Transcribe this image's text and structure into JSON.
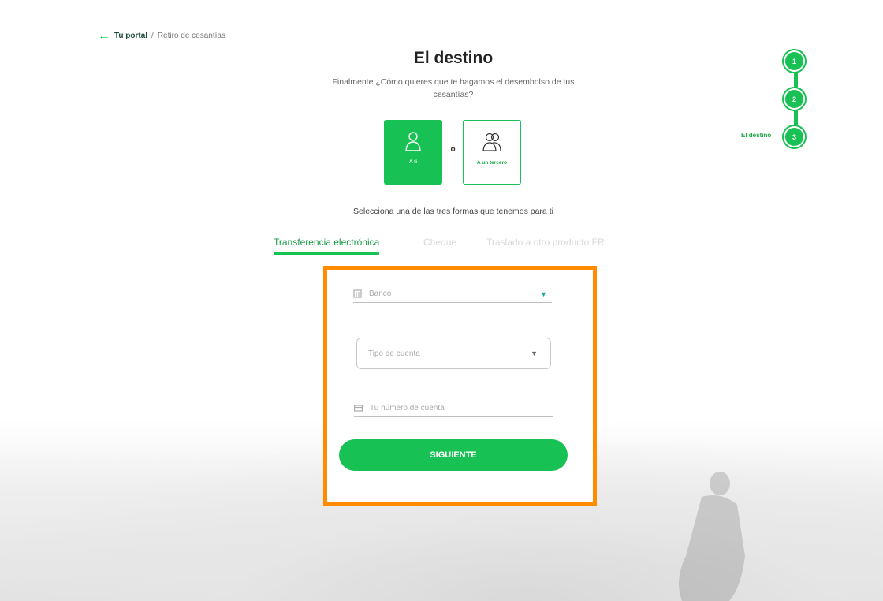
{
  "breadcrumb": {
    "back_icon": "arrow-left-icon",
    "portal": "Tu portal",
    "separator": "/",
    "current": "Retiro de cesantías"
  },
  "title": "El destino",
  "subtitle": "Finalmente ¿Cómo quieres que te hagamos el desembolso de tus cesantías?",
  "recipient_options": [
    {
      "label": "A ti",
      "icon": "person-icon",
      "selected": true
    },
    {
      "label": "A un tercero",
      "icon": "people-icon",
      "selected": false
    }
  ],
  "or_text": "o",
  "instruction": "Selecciona una de las tres formas que tenemos para ti",
  "tabs": [
    {
      "label": "Transferencia electrónica",
      "active": true
    },
    {
      "label": "Cheque",
      "active": false
    },
    {
      "label": "Traslado a otro producto FR",
      "active": false
    }
  ],
  "stepper": {
    "steps": [
      "1",
      "2",
      "3"
    ],
    "current_step": 3,
    "current_label": "El destino"
  },
  "form": {
    "bank_placeholder": "Banco",
    "account_type_placeholder": "Tipo de cuenta",
    "account_number_placeholder": "Tu número de cuenta",
    "submit_label": "SIGUIENTE"
  },
  "colors": {
    "primary": "#18c153",
    "highlight": "#ff8c00"
  }
}
